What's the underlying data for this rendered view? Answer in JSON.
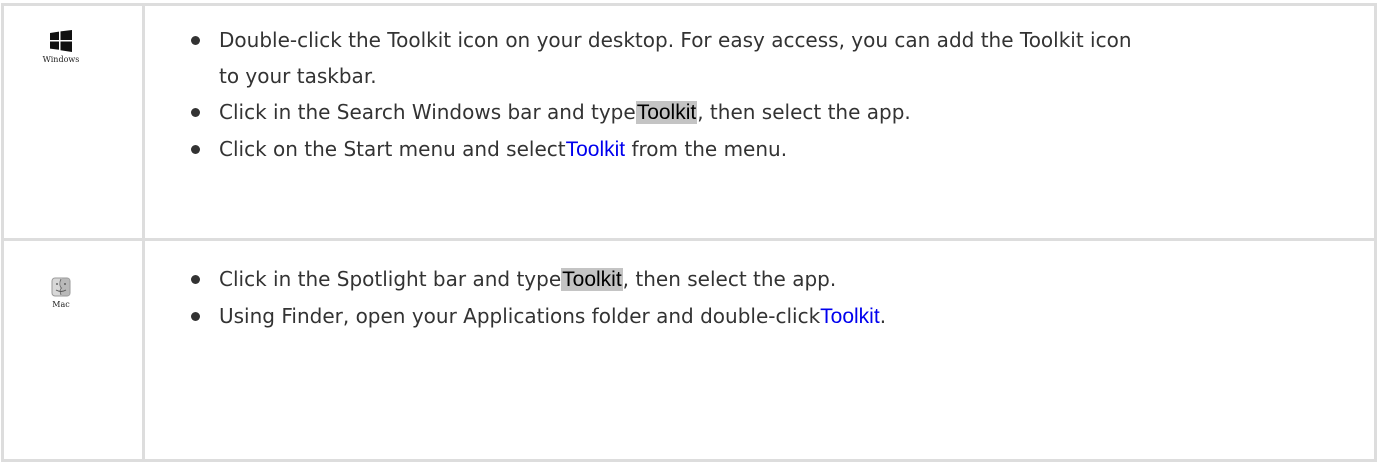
{
  "rows": [
    {
      "os_label": "Windows",
      "os_icon": "windows-logo-icon",
      "steps": [
        {
          "text": "Double-click the Toolkit icon on your desktop. For easy access, you can add the Toolkit icon to your taskbar."
        },
        {
          "before": "Click in the Search Windows bar and type",
          "highlight": "Toolkit",
          "after": ", then select the app."
        },
        {
          "before": "Click on the Start menu and select",
          "link": "Toolkit",
          "after": " from the menu."
        }
      ]
    },
    {
      "os_label": "Mac",
      "os_icon": "finder-logo-icon",
      "steps": [
        {
          "before": "Click in the Spotlight bar and type",
          "highlight": "Toolkit",
          "after": ", then select the app."
        },
        {
          "before": "Using Finder, open your Applications folder and double-click",
          "link": "Toolkit",
          "after": "."
        }
      ]
    }
  ],
  "colors": {
    "border": "#dddddd",
    "text": "#333333",
    "highlight_bg": "#c4c4c4",
    "link": "#0000ee"
  }
}
